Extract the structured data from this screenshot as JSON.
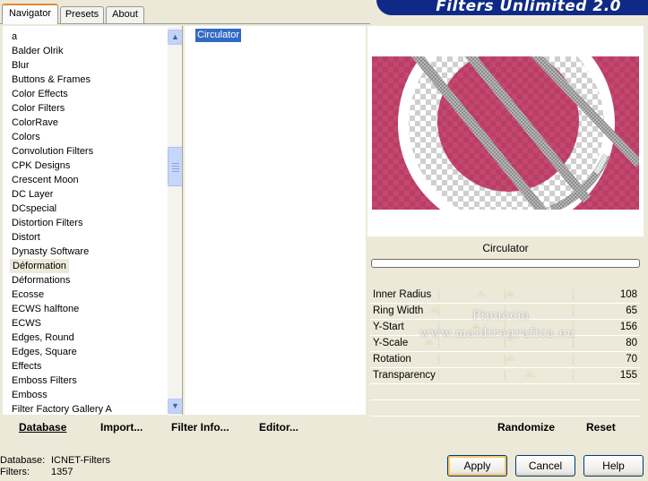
{
  "app": {
    "banner_title": "Filters Unlimited 2.0"
  },
  "tabs": [
    {
      "label": "Navigator",
      "active": true
    },
    {
      "label": "Presets",
      "active": false
    },
    {
      "label": "About",
      "active": false
    }
  ],
  "categories": [
    "a",
    "Balder Olrik",
    "Blur",
    "Buttons & Frames",
    "Color Effects",
    "Color Filters",
    "ColorRave",
    "Colors",
    "Convolution Filters",
    "CPK Designs",
    "Crescent Moon",
    "DC Layer",
    "DCspecial",
    "Distortion Filters",
    "Distort",
    "Dynasty Software",
    "Déformation",
    "Déformations",
    "Ecosse",
    "ECWS halftone",
    "ECWS",
    "Edges, Round",
    "Edges, Square",
    "Effects",
    "Emboss Filters",
    "Emboss",
    "Filter Factory Gallery A"
  ],
  "selected_category": "Déformation",
  "filters": [
    "Circulator"
  ],
  "selected_filter": "Circulator",
  "left_buttons": {
    "database": "Database",
    "import": "Import...",
    "filter_info": "Filter Info...",
    "editor": "Editor..."
  },
  "preview": {
    "filter_name": "Circulator",
    "colors": {
      "rose": "#c4476f",
      "checker_light": "#ffffff",
      "checker_dark": "#cfcfcf"
    }
  },
  "params": [
    {
      "label": "Inner Radius",
      "value": "108"
    },
    {
      "label": "Ring Width",
      "value": "65"
    },
    {
      "label": "Y-Start",
      "value": "156"
    },
    {
      "label": "Y-Scale",
      "value": "80"
    },
    {
      "label": "Rotation",
      "value": "70"
    },
    {
      "label": "Transparency",
      "value": "155"
    }
  ],
  "watermark": {
    "line1": "Pinuccia",
    "line2": "www.maldiregrafica.eu"
  },
  "right_buttons": {
    "randomize": "Randomize",
    "reset": "Reset"
  },
  "footer": {
    "database_label": "Database:",
    "database_value": "ICNET-Filters",
    "filters_label": "Filters:",
    "filters_value": "1357"
  },
  "dialog_buttons": {
    "apply": "Apply",
    "cancel": "Cancel",
    "help": "Help"
  },
  "icons": {
    "scroll_up": "scroll-up-arrow-icon",
    "scroll_down": "scroll-down-arrow-icon"
  }
}
